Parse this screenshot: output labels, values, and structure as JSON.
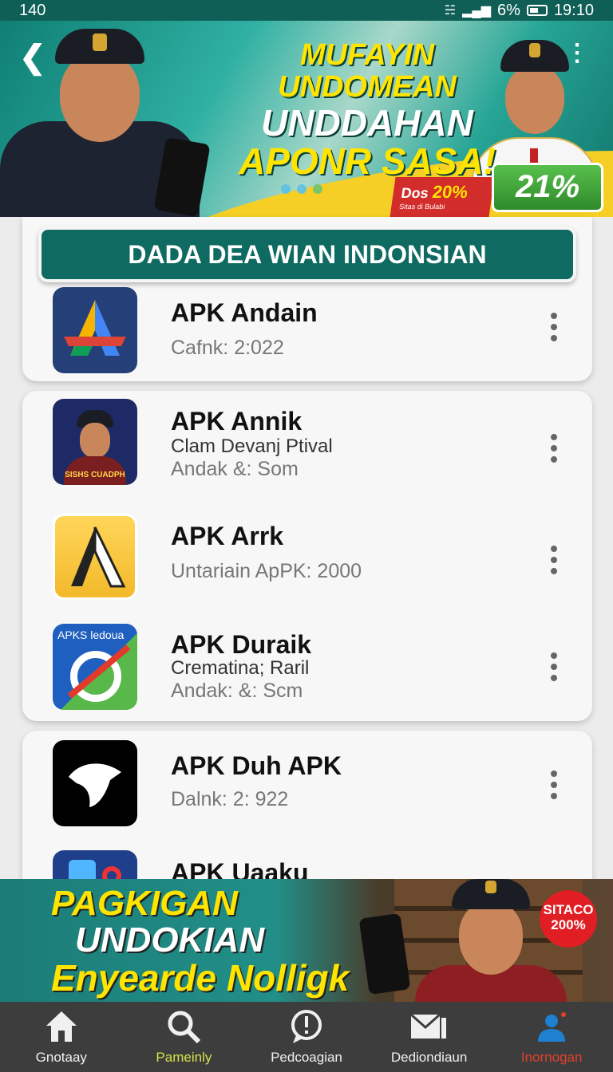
{
  "status_bar": {
    "left": "140",
    "battery_text": "6%",
    "time": "19:10"
  },
  "top_banner": {
    "line1": "MUFAYIN UNDOMEAN",
    "line2": "UNDDAHAN",
    "line3": "APONR SASA!",
    "promo_red_prefix": "Dos",
    "promo_red_value": "20%",
    "promo_red_small": "Sitas di Bulabi",
    "promo_green": "21%"
  },
  "section_header": "DADA DEA WIAN INDONSIAN",
  "apps": [
    {
      "title": "APK Andain",
      "subtitle": "",
      "meta": "Cafnk: 2:022"
    },
    {
      "title": "APK Annik",
      "subtitle": "Clam Devanj Ptival",
      "meta": "Andak &: Som",
      "icon_text": "SISHS CUADPH"
    },
    {
      "title": "APK Arrk",
      "subtitle": "",
      "meta": "Untariain ApPK: 2000"
    },
    {
      "title": "APK Duraik",
      "subtitle": "Crematina; Raril",
      "meta": "Andak: &: Scm",
      "icon_text": "APKS ledoua"
    },
    {
      "title": "APK Duh APK",
      "subtitle": "",
      "meta": "Dalnk: 2: 922"
    },
    {
      "title": "APK Uaaku",
      "subtitle": "",
      "meta": ""
    }
  ],
  "bottom_banner": {
    "line1": "PAGKIGAN",
    "line2": "UNDOKIAN",
    "line3": "Enyearde Nolligk",
    "badge_line1": "SITACO",
    "badge_line2": "200%"
  },
  "nav": [
    {
      "label": "Gnotaay",
      "icon": "home-icon"
    },
    {
      "label": "Pameinly",
      "icon": "search-icon"
    },
    {
      "label": "Pedcoagian",
      "icon": "alert-chat-icon"
    },
    {
      "label": "Dediondiaun",
      "icon": "mail-icon"
    },
    {
      "label": "Inornogan",
      "icon": "profile-icon"
    }
  ],
  "colors": {
    "teal": "#0f6b61",
    "yellow": "#ffe400",
    "red": "#d22d2a",
    "green": "#4aa63e"
  }
}
